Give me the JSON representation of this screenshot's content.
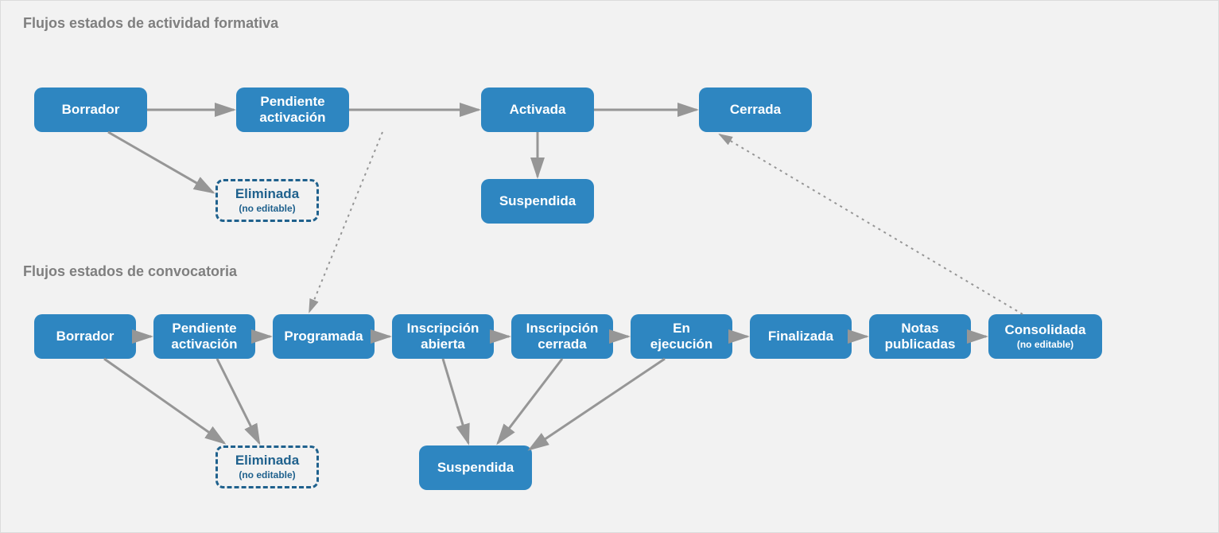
{
  "headings": {
    "activity": "Flujos estados de actividad formativa",
    "convocatoria": "Flujos estados de convocatoria"
  },
  "activity_nodes": {
    "borrador": "Borrador",
    "pendiente_l1": "Pendiente",
    "pendiente_l2": "activación",
    "activada": "Activada",
    "cerrada": "Cerrada",
    "eliminada_l1": "Eliminada",
    "eliminada_l2": "(no editable)",
    "suspendida": "Suspendida"
  },
  "conv_nodes": {
    "borrador": "Borrador",
    "pendiente_l1": "Pendiente",
    "pendiente_l2": "activación",
    "programada": "Programada",
    "inscripcion_abierta_l1": "Inscripción",
    "inscripcion_abierta_l2": "abierta",
    "inscripcion_cerrada_l1": "Inscripción",
    "inscripcion_cerrada_l2": "cerrada",
    "en_l1": "En",
    "en_l2": "ejecución",
    "finalizada": "Finalizada",
    "notas_l1": "Notas",
    "notas_l2": "publicadas",
    "consolidada_l1": "Consolidada",
    "consolidada_l2": "(no editable)",
    "eliminada_l1": "Eliminada",
    "eliminada_l2": "(no editable)",
    "suspendida": "Suspendida"
  },
  "colors": {
    "node_fill": "#2e86c1",
    "node_dashed_border": "#1f618d",
    "arrow": "#969696",
    "heading": "#7f7f7f",
    "canvas_bg": "#f2f2f2"
  }
}
